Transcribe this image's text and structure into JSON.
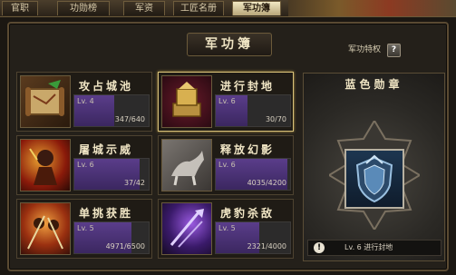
{
  "tabs": [
    {
      "label": "官职",
      "active": false
    },
    {
      "label": "功勋榜",
      "active": false
    },
    {
      "label": "军资",
      "active": false
    },
    {
      "label": "工匠名册",
      "active": false
    },
    {
      "label": "军功簿",
      "active": true
    }
  ],
  "title": "军功簿",
  "privilege_label": "军功特权",
  "help_label": "?",
  "cards": [
    {
      "name": "攻占城池",
      "level": "Lv. 4",
      "progress": "347/640",
      "fraction": 0.542,
      "icon": "scroll-map-icon"
    },
    {
      "name": "进行封地",
      "level": "Lv. 6",
      "progress": "30/70",
      "fraction": 0.429,
      "icon": "golden-seal-icon"
    },
    {
      "name": "屠城示威",
      "level": "Lv. 6",
      "progress": "37/42",
      "fraction": 0.881,
      "icon": "fire-warrior-icon"
    },
    {
      "name": "释放幻影",
      "level": "Lv. 6",
      "progress": "4035/4200",
      "fraction": 0.961,
      "icon": "phantom-horse-icon"
    },
    {
      "name": "单挑获胜",
      "level": "Lv. 5",
      "progress": "4971/6500",
      "fraction": 0.765,
      "icon": "duel-warriors-icon"
    },
    {
      "name": "虎豹杀敌",
      "level": "Lv. 5",
      "progress": "2321/4000",
      "fraction": 0.58,
      "icon": "purple-blades-icon"
    }
  ],
  "medal": {
    "title": "蓝色勋章",
    "icon": "blue-shield-medal-icon",
    "status_level": "Lv. 6",
    "status_text": "进行封地"
  },
  "colors": {
    "accent": "#d9c27a",
    "progress": "#4a3275"
  }
}
